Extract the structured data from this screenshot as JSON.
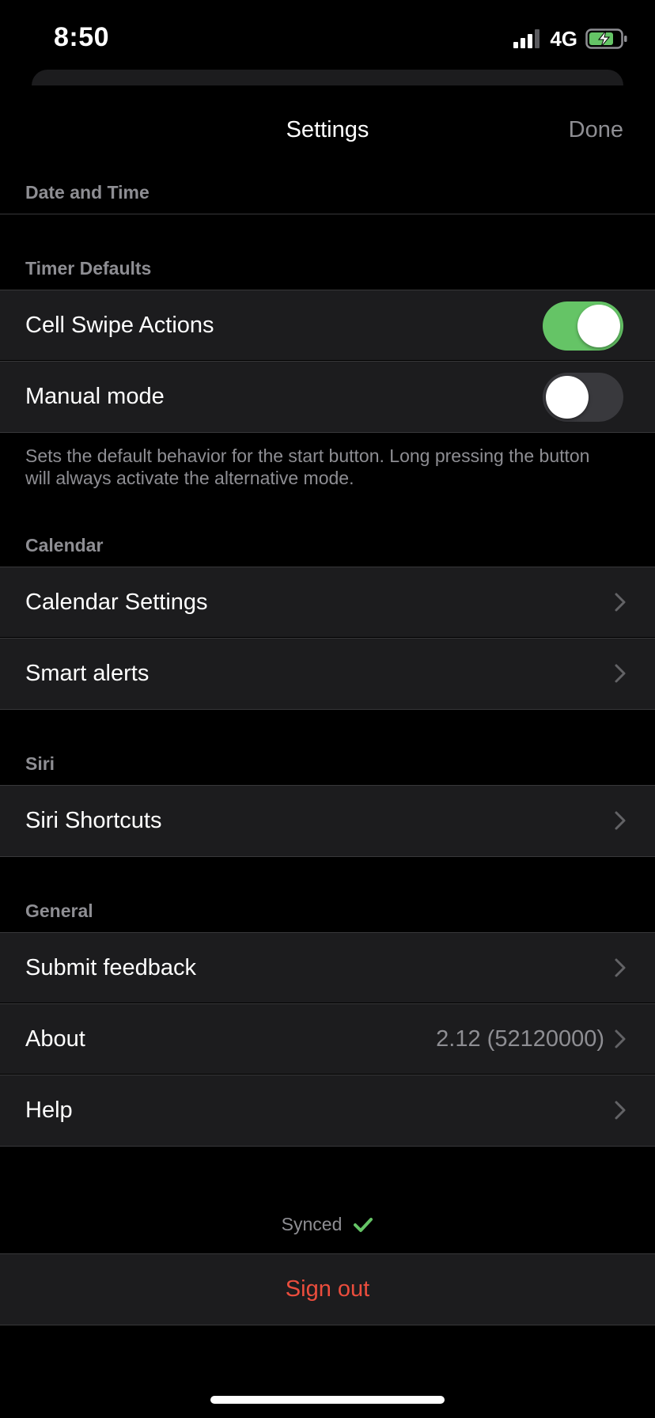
{
  "status_bar": {
    "time": "8:50",
    "network": "4G",
    "signal_icon": "signal-bars-icon",
    "battery_icon": "battery-charging-icon",
    "battery_color": "#65c466"
  },
  "nav": {
    "title": "Settings",
    "done_label": "Done"
  },
  "sections": {
    "date_time": {
      "header": "Date and Time"
    },
    "timer_defaults": {
      "header": "Timer Defaults",
      "rows": [
        {
          "label": "Cell Swipe Actions",
          "toggle": "on"
        },
        {
          "label": "Manual mode",
          "toggle": "off"
        }
      ],
      "footer": "Sets the default behavior for the start button. Long pressing the button will always activate the alternative mode."
    },
    "calendar": {
      "header": "Calendar",
      "rows": [
        {
          "label": "Calendar Settings",
          "icon": "chevron-right-icon"
        },
        {
          "label": "Smart alerts",
          "icon": "chevron-right-icon"
        }
      ]
    },
    "siri": {
      "header": "Siri",
      "rows": [
        {
          "label": "Siri Shortcuts",
          "icon": "chevron-right-icon"
        }
      ]
    },
    "general": {
      "header": "General",
      "rows": [
        {
          "label": "Submit feedback",
          "icon": "chevron-right-icon"
        },
        {
          "label": "About",
          "value": "2.12 (52120000)",
          "icon": "chevron-right-icon"
        },
        {
          "label": "Help",
          "icon": "chevron-right-icon"
        }
      ]
    }
  },
  "sync": {
    "label": "Synced",
    "icon": "checkmark-icon",
    "color": "#65c466"
  },
  "sign_out": {
    "label": "Sign out",
    "color": "#eb4d3d"
  },
  "colors": {
    "background": "#000000",
    "cell": "#1c1c1e",
    "separator": "#38383a",
    "secondary_text": "#8e8e93",
    "toggle_on": "#65c466",
    "toggle_off": "#39393d"
  }
}
